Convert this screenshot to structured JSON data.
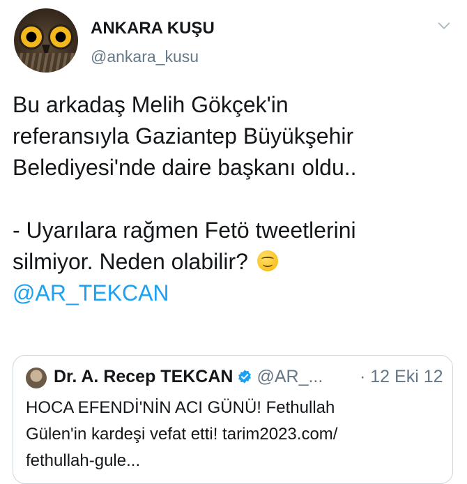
{
  "author": {
    "display_name": "ANKARA KUŞU",
    "handle": "@ankara_kusu",
    "avatar_icon": "owl-avatar"
  },
  "tweet": {
    "lines_paragraph1": [
      "Bu arkadaş Melih Gökçek'in",
      "referansıyla Gaziantep Büyükşehir",
      "Belediyesi'nde daire başkanı oldu.."
    ],
    "lines_paragraph2": [
      "- Uyarılara rağmen Fetö tweetlerini",
      "silmiyor. Neden olabilir?"
    ],
    "emoji": "smiling-face-icon",
    "mention": "@AR_TEKCAN"
  },
  "quoted_tweet": {
    "name": "Dr. A. Recep TEKCAN",
    "handle": "@AR_...",
    "date": "· 12 Eki 12",
    "verified_icon": "verified-badge-icon",
    "text_lines": [
      "HOCA EFENDİ'NİN ACI GÜNÜ! Fethullah",
      "Gülen'in kardeşi vefat etti! tarim2023.com/",
      "fethullah-gule..."
    ]
  },
  "colors": {
    "link": "#1da1f2",
    "secondary_text": "#657786",
    "border": "#ccd6dd"
  }
}
